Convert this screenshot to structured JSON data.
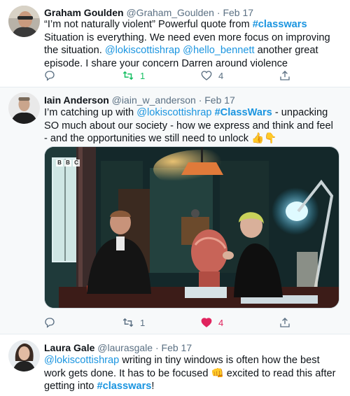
{
  "tweets": [
    {
      "name": "Graham Goulden",
      "handle": "@Graham_Goulden",
      "separator": "·",
      "date": "Feb 17",
      "text_parts": {
        "p1": "“I’m not naturally violent” Powerful quote from ",
        "tag1": "#classwars",
        "p2": " Situation is everything. We need even more focus on improving the situation. ",
        "mention1": "@lokiscottishrap",
        "p3": " ",
        "mention2": "@hello_bennett",
        "p4": " another great episode. I share your concern Darren around violence"
      },
      "retweets": "1",
      "likes": "4",
      "retweeted": true,
      "liked": false
    },
    {
      "name": "Iain Anderson",
      "handle": "@iain_w_anderson",
      "separator": "·",
      "date": "Feb 17",
      "text_parts": {
        "p1": "I’m catching up with ",
        "mention1": "@lokiscottishrap",
        "p2": " ",
        "tag1": "#ClassWars",
        "p3": " - unpacking SO much about our society - how we express and think and feel - and the opportunities we still need to unlock 👍👇"
      },
      "media_watermark": "BBC",
      "retweets": "1",
      "likes": "4",
      "retweeted": false,
      "liked": true
    },
    {
      "name": "Laura Gale",
      "handle": "@laurasgale",
      "separator": "·",
      "date": "Feb 17",
      "text_parts": {
        "mention1": "@lokiscottishrap",
        "p1": " writing in tiny windows is often how the best work gets done. It has to be focused 👊 excited to read this after getting into ",
        "tag1": "#classwars",
        "p2": "!"
      }
    }
  ],
  "colors": {
    "link": "#1b95e0",
    "retweet_active": "#17bf63",
    "like_active": "#e0245e",
    "muted": "#5b7083"
  }
}
